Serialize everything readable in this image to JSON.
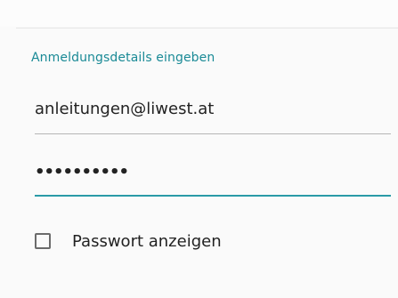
{
  "section_title": "Anmeldungsdetails eingeben",
  "email": {
    "value": "anleitungen@liwest.at"
  },
  "password": {
    "masked_value": "••••••••••"
  },
  "show_password": {
    "label": "Passwort anzeigen",
    "checked": false
  },
  "colors": {
    "accent": "#1a8a96",
    "background": "#fafafa",
    "text": "#222222"
  }
}
